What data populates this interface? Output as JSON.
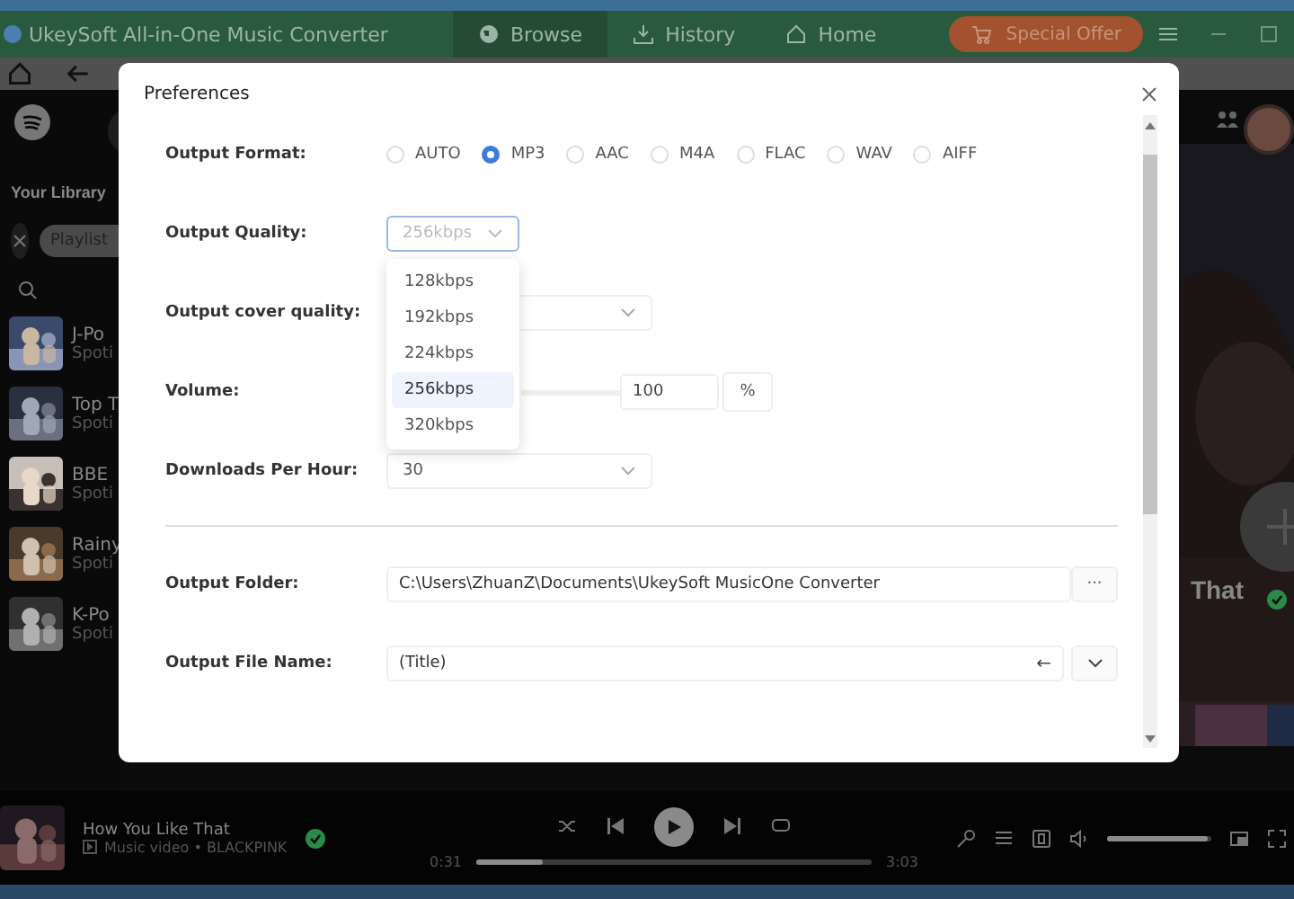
{
  "window": {
    "title": "UkeySoft All-in-One Music Converter"
  },
  "tabs": [
    {
      "label": "Browse",
      "selected": true
    },
    {
      "label": "History",
      "selected": false
    },
    {
      "label": "Home",
      "selected": false
    }
  ],
  "special_offer": "Special Offer",
  "library": {
    "title": "Your Library",
    "filter_chip": "Playlist",
    "items": [
      {
        "title": "J-Po",
        "subtitle": "Spoti"
      },
      {
        "title": "Top T",
        "subtitle": "Spoti"
      },
      {
        "title": "BBE",
        "subtitle": "Spoti"
      },
      {
        "title": "Rainy",
        "subtitle": "Spoti"
      },
      {
        "title": "K-Po",
        "subtitle": "Spoti"
      }
    ]
  },
  "hero": {
    "title_fragment": "That"
  },
  "preferences": {
    "title": "Preferences",
    "output_format": {
      "label": "Output Format:",
      "options": [
        {
          "label": "AUTO",
          "selected": false
        },
        {
          "label": "MP3",
          "selected": true
        },
        {
          "label": "AAC",
          "selected": false
        },
        {
          "label": "M4A",
          "selected": false
        },
        {
          "label": "FLAC",
          "selected": false
        },
        {
          "label": "WAV",
          "selected": false
        },
        {
          "label": "AIFF",
          "selected": false
        }
      ]
    },
    "output_quality": {
      "label": "Output Quality:",
      "value": "256kbps",
      "expanded": true,
      "options": [
        {
          "label": "128kbps",
          "selected": false
        },
        {
          "label": "192kbps",
          "selected": false
        },
        {
          "label": "224kbps",
          "selected": false
        },
        {
          "label": "256kbps",
          "selected": true
        },
        {
          "label": "320kbps",
          "selected": false
        }
      ]
    },
    "cover_quality": {
      "label": "Output cover quality:"
    },
    "volume": {
      "label": "Volume:",
      "value": "100",
      "unit": "%"
    },
    "downloads_per_hour": {
      "label": "Downloads Per Hour:",
      "value": "30"
    },
    "output_folder": {
      "label": "Output Folder:",
      "value": "C:\\Users\\ZhuanZ\\Documents\\UkeySoft MusicOne Converter",
      "browse": "···"
    },
    "output_file_name": {
      "label": "Output File Name:",
      "value": "(Title)",
      "insert": "←"
    }
  },
  "player": {
    "title": "How You Like That",
    "subtitle": "Music video • BLACKPINK",
    "elapsed": "0:31",
    "duration": "3:03",
    "level": 0.17,
    "volume": {
      "level": 0.97
    }
  }
}
